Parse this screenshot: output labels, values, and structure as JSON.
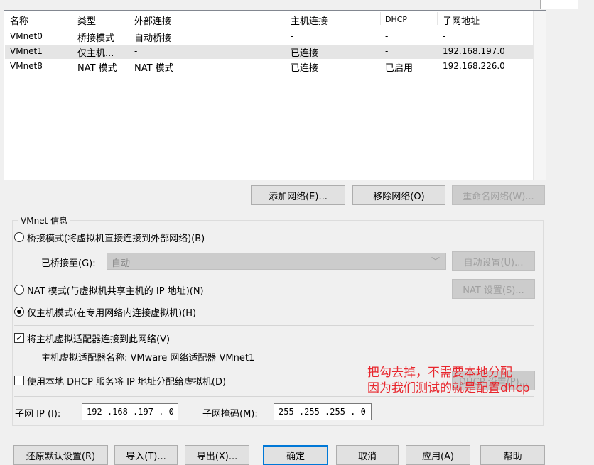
{
  "table": {
    "headers": [
      "名称",
      "类型",
      "外部连接",
      "主机连接",
      "DHCP",
      "子网地址"
    ],
    "rows": [
      {
        "name": "VMnet0",
        "type": "桥接模式",
        "external": "自动桥接",
        "host": "-",
        "dhcp": "-",
        "subnet": "-"
      },
      {
        "name": "VMnet1",
        "type": "仅主机...",
        "external": "-",
        "host": "已连接",
        "dhcp": "-",
        "subnet": "192.168.197.0"
      },
      {
        "name": "VMnet8",
        "type": "NAT 模式",
        "external": "NAT 模式",
        "host": "已连接",
        "dhcp": "已启用",
        "subnet": "192.168.226.0"
      }
    ],
    "selected_row": 1
  },
  "network_buttons": {
    "add": "添加网络(E)...",
    "remove": "移除网络(O)",
    "rename": "重命名网络(W)..."
  },
  "vmnet_info": {
    "title": "VMnet 信息",
    "bridged_label": "桥接模式(将虚拟机直接连接到外部网络)(B)",
    "bridged_to_label": "已桥接至(G):",
    "bridged_to_value": "自动",
    "auto_settings": "自动设置(U)...",
    "nat_label": "NAT 模式(与虚拟机共享主机的 IP 地址)(N)",
    "nat_settings": "NAT 设置(S)...",
    "host_only_label": "仅主机模式(在专用网络内连接虚拟机)(H)",
    "selected_mode": "host_only",
    "connect_adapter_label": "将主机虚拟适配器连接到此网络(V)",
    "connect_adapter_checked": true,
    "adapter_name_label": "主机虚拟适配器名称: VMware 网络适配器 VMnet1",
    "dhcp_label": "使用本地 DHCP 服务将 IP 地址分配给虚拟机(D)",
    "dhcp_checked": false,
    "dhcp_settings": "DHCP 设置(P)...",
    "subnet_ip_label": "子网 IP (I):",
    "subnet_ip_value": "192 .168 .197 . 0",
    "subnet_mask_label": "子网掩码(M):",
    "subnet_mask_value": "255 .255 .255 . 0"
  },
  "annotation": {
    "line1": "把勾去掉，不需要本地分配",
    "line2": "因为我们测试的就是配置dhcp",
    "color": "#e8262d"
  },
  "footer": {
    "restore": "还原默认设置(R)",
    "import": "导入(T)...",
    "export": "导出(X)...",
    "ok": "确定",
    "cancel": "取消",
    "apply": "应用(A)",
    "help": "帮助"
  }
}
